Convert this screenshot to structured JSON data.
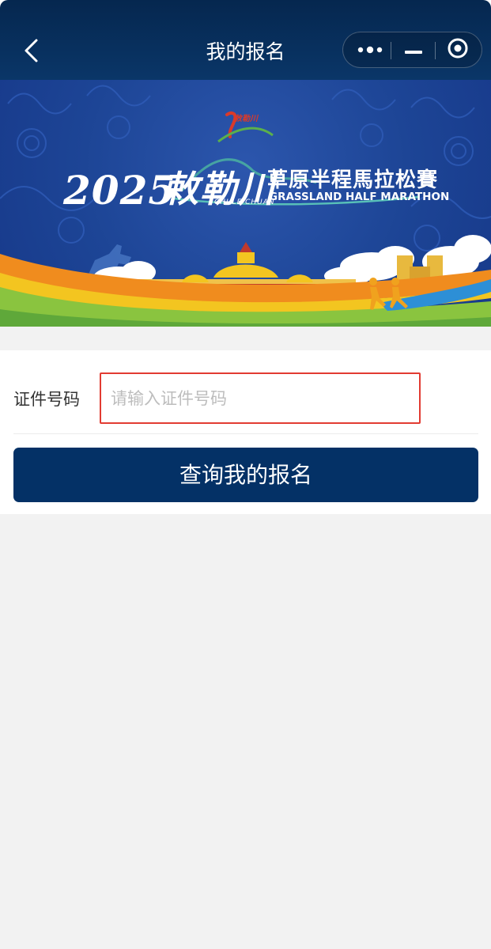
{
  "navbar": {
    "title": "我的报名",
    "back_icon": "chevron-left-icon",
    "capsule": {
      "more_icon": "more-dots-icon",
      "minimize_icon": "minimize-icon",
      "close_icon": "target-circle-icon"
    },
    "colors": {
      "background": "#05274f",
      "text": "#ffffff"
    }
  },
  "banner": {
    "logo_text": "敕勒川",
    "year": "2025",
    "event_name": "敕勒川",
    "pinyin": "CHI LE CHUAN",
    "race_cn": "草原半程馬拉松賽",
    "race_en": "GRASSLAND HALF MARATHON",
    "colors": {
      "sky": "#1d4596",
      "grass": "#8ac43f",
      "yellow": "#f3c520",
      "orange": "#f08c1e"
    }
  },
  "form": {
    "id_label": "证件号码",
    "id_input": {
      "value": "",
      "placeholder": "请输入证件号码"
    },
    "submit_label": "查询我的报名",
    "colors": {
      "button": "#043166",
      "input_border": "#e23b32"
    }
  }
}
